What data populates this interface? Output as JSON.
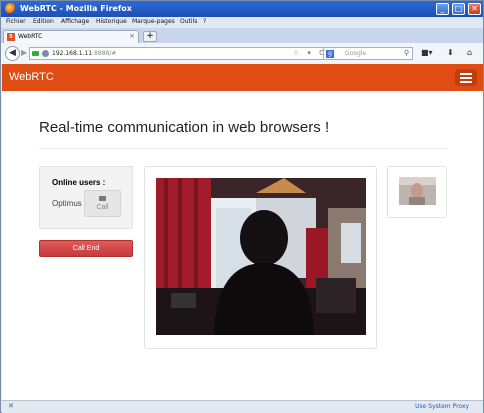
{
  "window": {
    "title": "WebRTC - Mozilla Firefox",
    "minimize": "_",
    "maximize": "□",
    "close": "✕"
  },
  "menu": [
    "Fichier",
    "Edition",
    "Affichage",
    "Historique",
    "Marque-pages",
    "Outils",
    "?"
  ],
  "tab": {
    "label": "WebRTC",
    "close": "×",
    "new_tab": "+"
  },
  "nav": {
    "back": "◀",
    "forward": "▶",
    "address_host": "192.168.1.11",
    "address_rest": ":8888/#",
    "url_icons": "☆ ▾ C",
    "search_placeholder": "Google",
    "search_engine": "g",
    "search_icon": "⚲",
    "download_icon": "⬇",
    "home_icon": "⌂",
    "camera_icon": "■▾"
  },
  "app": {
    "brand": "WebRTC",
    "headline": "Real-time communication in web browsers !",
    "users_heading": "Online users :",
    "user_name": "Optimus",
    "call_label": "Call",
    "end_label": "Call End"
  },
  "status": {
    "close_icon": "✕",
    "proxy": "Use System Proxy"
  },
  "colors": {
    "header": "#e04d14",
    "end_button": "#d44a4a",
    "titlebar": "#1d4fb8"
  }
}
